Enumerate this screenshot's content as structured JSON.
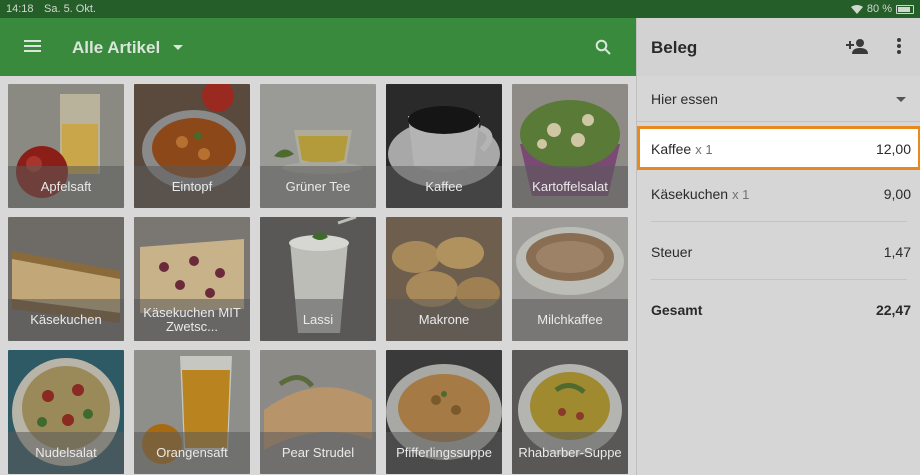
{
  "status_bar": {
    "time": "14:18",
    "date": "Sa. 5. Okt.",
    "battery": "80 %"
  },
  "app_bar": {
    "title": "Alle Artikel"
  },
  "items": [
    {
      "label": "Apfelsaft"
    },
    {
      "label": "Eintopf"
    },
    {
      "label": "Grüner Tee"
    },
    {
      "label": "Kaffee"
    },
    {
      "label": "Kartoffelsalat"
    },
    {
      "label": "Käsekuchen"
    },
    {
      "label": "Käsekuchen MIT Zwetsc..."
    },
    {
      "label": "Lassi"
    },
    {
      "label": "Makrone"
    },
    {
      "label": "Milchkaffee"
    },
    {
      "label": "Nudelsalat"
    },
    {
      "label": "Orangensaft"
    },
    {
      "label": "Pear Strudel"
    },
    {
      "label": "Pfifferlingssuppe"
    },
    {
      "label": "Rhabarber-Suppe"
    }
  ],
  "receipt": {
    "title": "Beleg",
    "mode": "Hier essen",
    "lines": [
      {
        "name": "Kaffee",
        "qty": "x 1",
        "price": "12,00"
      },
      {
        "name": "Käsekuchen",
        "qty": "x 1",
        "price": "9,00"
      }
    ],
    "tax_label": "Steuer",
    "tax_value": "1,47",
    "total_label": "Gesamt",
    "total_value": "22,47"
  },
  "colors": {
    "accent": "#3a8a3e",
    "status_bar": "#255e29",
    "highlight": "#e8891d"
  }
}
